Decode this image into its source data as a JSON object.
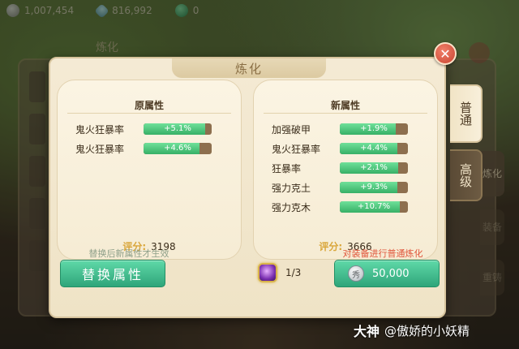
{
  "top_bar": {
    "coins": "1,007,454",
    "gems": "816,992",
    "jade": "0"
  },
  "back_window": {
    "title": "炼化",
    "tabs": [
      "炼化",
      "装备",
      "重铸"
    ]
  },
  "dialog": {
    "title": "炼化",
    "close_label": "✕",
    "left_panel": {
      "heading": "原属性",
      "attributes": [
        {
          "name": "鬼火狂暴率",
          "value": "+5.1%",
          "fill": 0.9
        },
        {
          "name": "鬼火狂暴率",
          "value": "+4.6%",
          "fill": 0.82
        }
      ],
      "score_label": "评分:",
      "score_value": "3198"
    },
    "right_panel": {
      "heading": "新属性",
      "attributes": [
        {
          "name": "加强破甲",
          "value": "+1.9%",
          "fill": 0.82
        },
        {
          "name": "鬼火狂暴率",
          "value": "+4.4%",
          "fill": 0.84
        },
        {
          "name": "狂暴率",
          "value": "+2.1%",
          "fill": 0.86
        },
        {
          "name": "强力克土",
          "value": "+9.3%",
          "fill": 0.84
        },
        {
          "name": "强力克木",
          "value": "+10.7%",
          "fill": 0.88
        }
      ],
      "score_label": "评分:",
      "score_value": "3666"
    },
    "hint_left": "替换后新属性才生效",
    "hint_right": "对装备进行普通炼化",
    "replace_button": "替换属性",
    "stone_count": "1/3",
    "refine_cost": "50,000",
    "money_symbol": "秀"
  },
  "side_tabs": {
    "normal": "普通",
    "advanced": "高级"
  },
  "watermark": {
    "brand": "大神",
    "user": "@傲娇的小妖精"
  },
  "colors": {
    "accent_green": "#37b066",
    "score_gold": "#d9a63a",
    "hint_red": "#e0543a",
    "close_red": "#c94532"
  }
}
